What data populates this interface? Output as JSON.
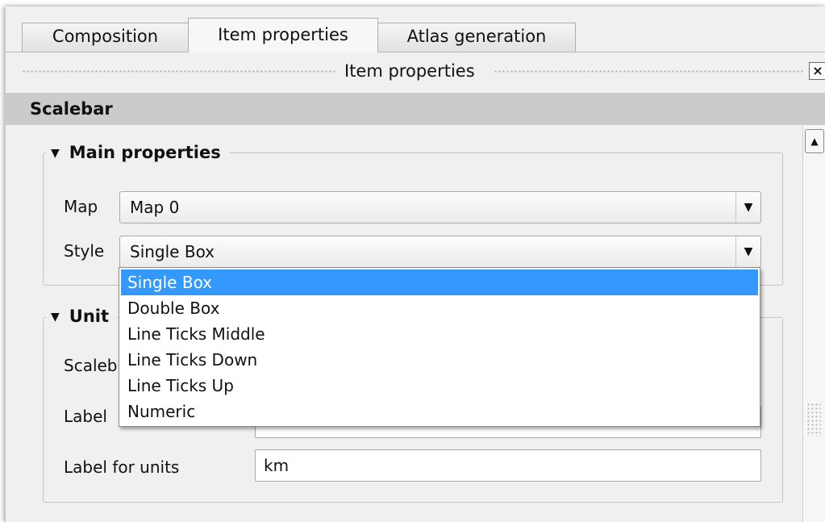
{
  "tabs": [
    {
      "label": "Composition"
    },
    {
      "label": "Item properties"
    },
    {
      "label": "Atlas generation"
    }
  ],
  "dock": {
    "title": "Item properties",
    "close_icon": "×"
  },
  "header": {
    "title": "Scalebar"
  },
  "main_properties": {
    "title": "Main properties",
    "map_label": "Map",
    "map_value": "Map 0",
    "style_label": "Style",
    "style_value": "Single Box"
  },
  "units": {
    "title": "Unit",
    "scalebar_label": "Scaleb",
    "label_label": "Label",
    "label_for_units_label": "Label for units",
    "label_for_units_value": "km"
  },
  "style_dropdown": {
    "options": [
      "Single Box",
      "Double Box",
      "Line Ticks Middle",
      "Line Ticks Down",
      "Line Ticks Up",
      "Numeric"
    ],
    "selected_index": 0,
    "highlight_color": "#3399ff"
  },
  "icons": {
    "collapse": "▼",
    "dropdown_arrow": "▼",
    "scroll_up": "▲"
  }
}
